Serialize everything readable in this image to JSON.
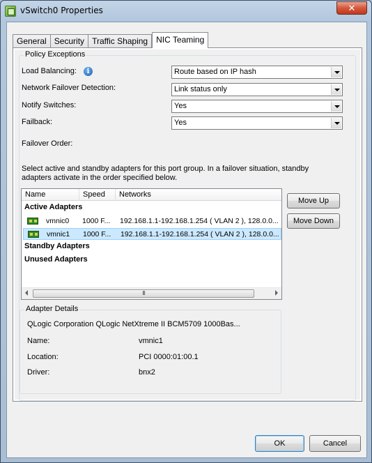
{
  "window": {
    "title": "vSwitch0 Properties",
    "close_glyph": "✕"
  },
  "tabs": [
    {
      "label": "General"
    },
    {
      "label": "Security"
    },
    {
      "label": "Traffic Shaping"
    },
    {
      "label": "NIC Teaming",
      "active": true
    }
  ],
  "policy": {
    "legend": "Policy Exceptions",
    "load_balancing_label": "Load Balancing:",
    "load_balancing_value": "Route based on IP hash",
    "failover_detection_label": "Network Failover Detection:",
    "failover_detection_value": "Link status only",
    "notify_switches_label": "Notify Switches:",
    "notify_switches_value": "Yes",
    "failback_label": "Failback:",
    "failback_value": "Yes"
  },
  "failover": {
    "label": "Failover Order:",
    "description": "Select active and standby adapters for this port group.  In a failover situation, standby adapters activate  in the order specified below."
  },
  "adapters": {
    "columns": [
      "Name",
      "Speed",
      "Networks"
    ],
    "groups": {
      "active": "Active Adapters",
      "standby": "Standby Adapters",
      "unused": "Unused Adapters"
    },
    "rows": [
      {
        "name": "vmnic0",
        "speed": "1000 F...",
        "networks": "192.168.1.1-192.168.1.254 ( VLAN 2 ), 128.0.0...",
        "selected": false
      },
      {
        "name": "vmnic1",
        "speed": "1000 F...",
        "networks": "192.168.1.1-192.168.1.254 ( VLAN 2 ), 128.0.0...",
        "selected": true
      }
    ],
    "scroll_grip": "III"
  },
  "buttons": {
    "move_up": "Move Up",
    "move_down": "Move Down",
    "ok": "OK",
    "cancel": "Cancel"
  },
  "details": {
    "legend": "Adapter Details",
    "description": "QLogic Corporation QLogic NetXtreme II BCM5709 1000Bas...",
    "name_label": "Name:",
    "name_value": "vmnic1",
    "location_label": "Location:",
    "location_value": "PCI 0000:01:00.1",
    "driver_label": "Driver:",
    "driver_value": "bnx2"
  },
  "colors": {
    "selection": "#cce8ff",
    "title_bar": "#b2c6dc",
    "close_button": "#c13a1e"
  }
}
